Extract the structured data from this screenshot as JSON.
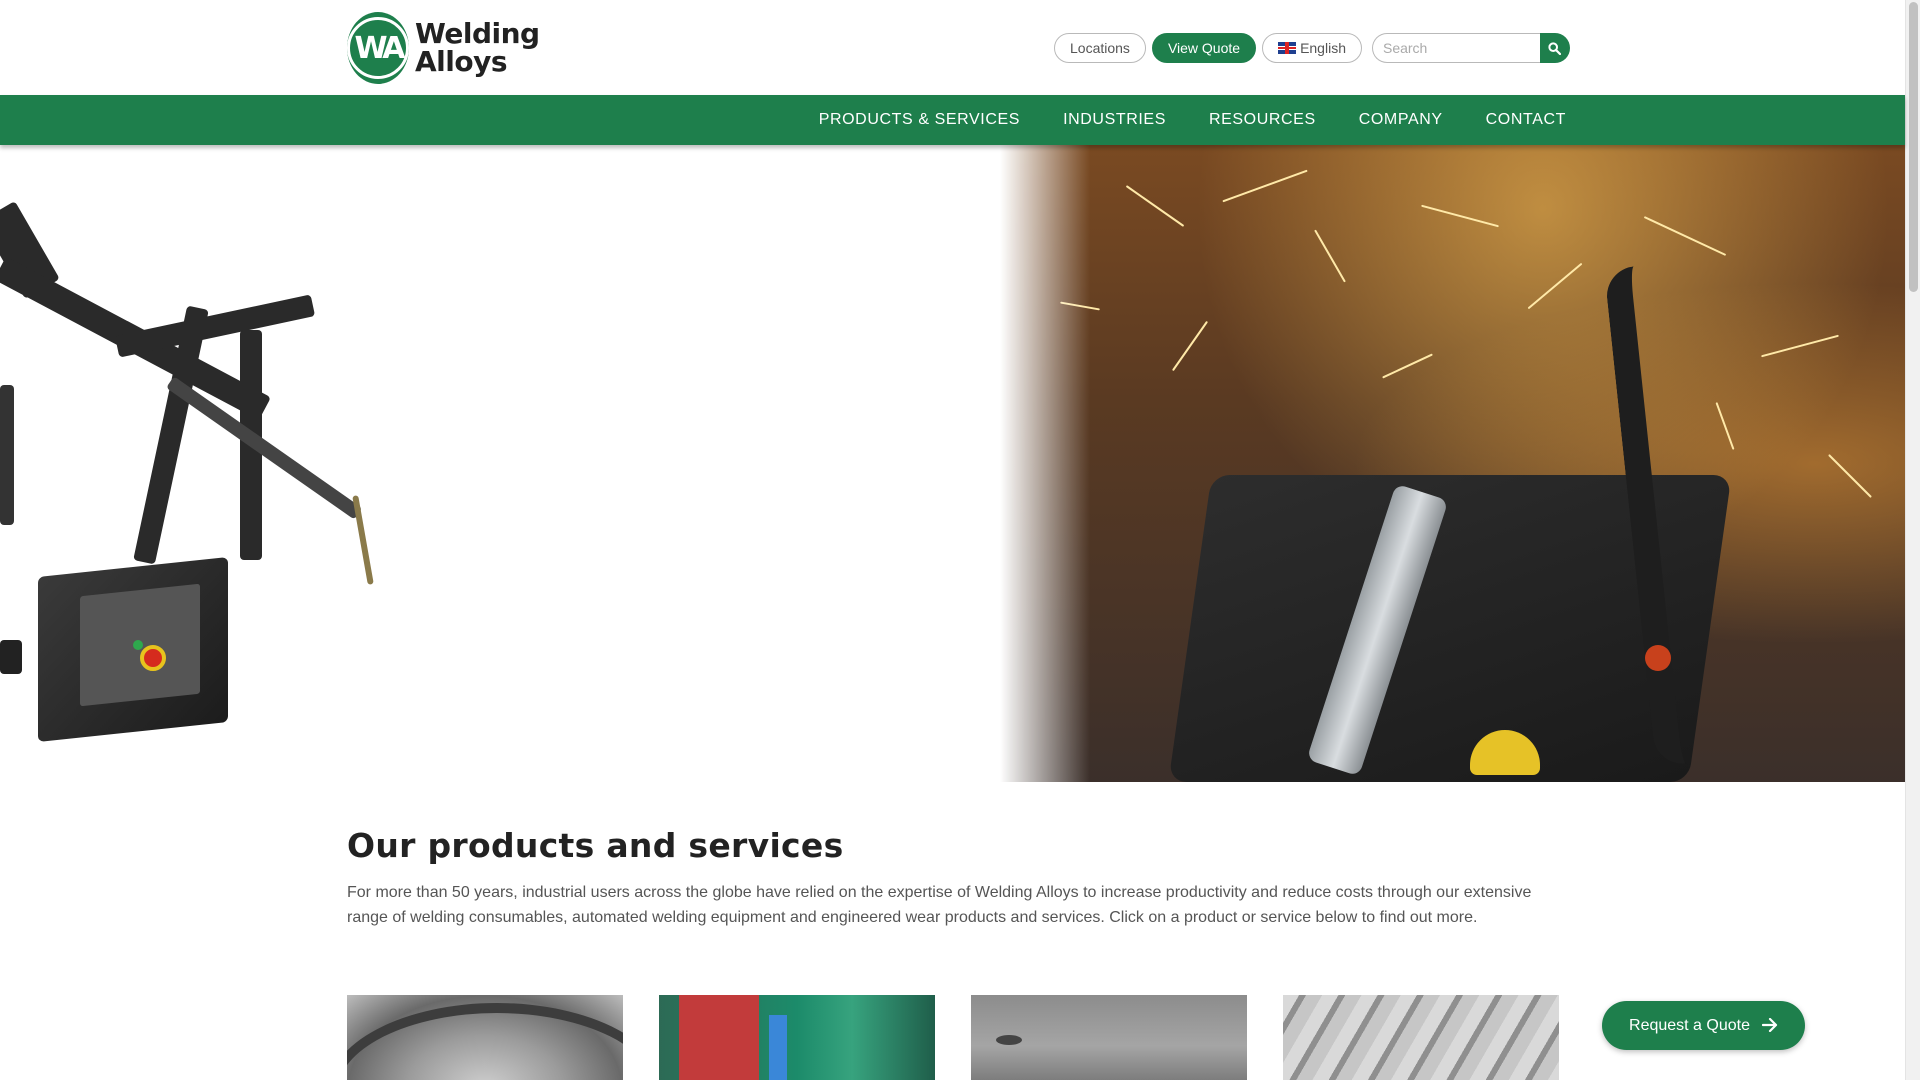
{
  "brand": {
    "logo_line1": "Welding",
    "logo_line2": "Alloys",
    "logo_mark": "WA",
    "primary_color": "#1e7f4c"
  },
  "top_bar": {
    "locations_label": "Locations",
    "view_quote_label": "View Quote",
    "language_label": "English",
    "language_icon": "uk-flag-icon",
    "search": {
      "placeholder": "Search",
      "value": "",
      "icon": "search-icon"
    }
  },
  "nav": {
    "items": [
      {
        "label": "PRODUCTS & SERVICES"
      },
      {
        "label": "INDUSTRIES"
      },
      {
        "label": "RESOURCES"
      },
      {
        "label": "COMPANY"
      },
      {
        "label": "CONTACT"
      }
    ]
  },
  "main": {
    "section_title": "Our products and services",
    "section_description": "For more than 50 years, industrial users across the globe have relied on the expertise of Welding Alloys to increase productivity and reduce costs through our extensive range of welding consumables, automated welding equipment and engineered wear products and services. Click on a product or service below to find out more."
  },
  "floating": {
    "request_quote_label": "Request a Quote",
    "request_quote_icon": "arrow-right-icon"
  }
}
